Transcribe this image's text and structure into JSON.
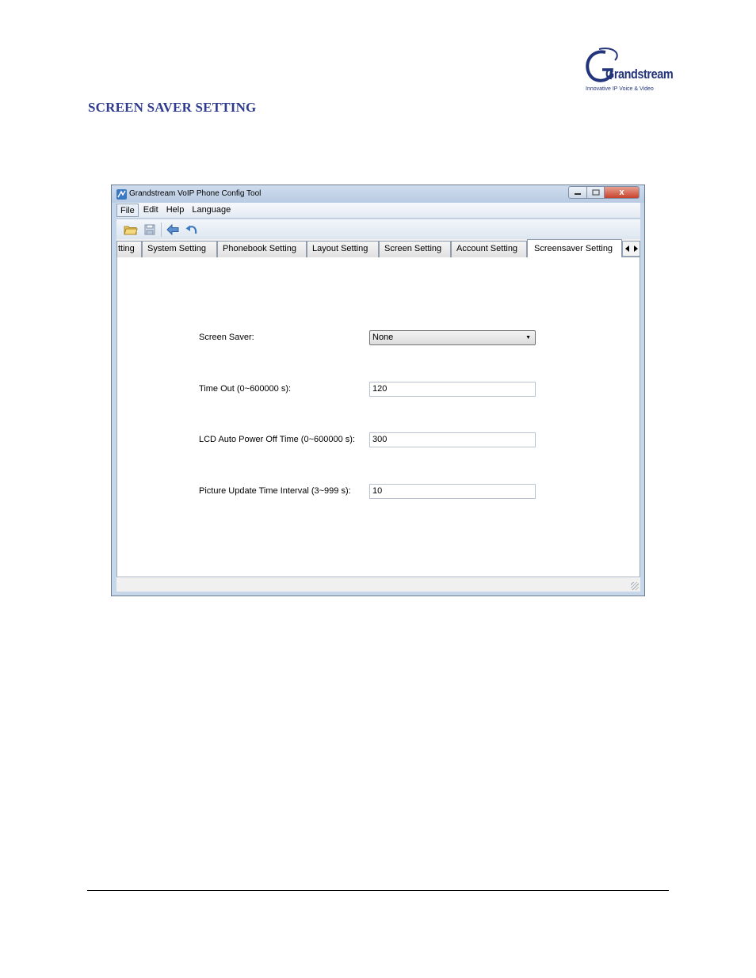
{
  "header": {
    "logo": {
      "name": "Grandstream",
      "tagline": "Innovative IP Voice & Video"
    },
    "section_title": "SCREEN SAVER SETTING"
  },
  "window": {
    "title": "Grandstream VoIP Phone Config Tool",
    "controls": {
      "minimize_icon": "minimize-icon",
      "maximize_icon": "maximize-icon",
      "close": "x"
    },
    "menu": [
      {
        "label": "File"
      },
      {
        "label": "Edit"
      },
      {
        "label": "Help"
      },
      {
        "label": "Language"
      }
    ],
    "toolbar": [
      "open-folder-icon",
      "save-icon",
      "back-arrow-icon",
      "undo-icon"
    ],
    "tabs": [
      {
        "label": "tting"
      },
      {
        "label": "System Setting"
      },
      {
        "label": "Phonebook Setting"
      },
      {
        "label": "Layout Setting"
      },
      {
        "label": "Screen Setting"
      },
      {
        "label": "Account Setting"
      },
      {
        "label": "Screensaver Setting",
        "selected": true
      }
    ],
    "form": {
      "screen_saver": {
        "label": "Screen Saver:",
        "value": "None"
      },
      "time_out": {
        "label": "Time Out (0~600000 s):",
        "value": "120"
      },
      "lcd_off": {
        "label": "LCD Auto Power Off Time (0~600000 s):",
        "value": "300"
      },
      "picture_interval": {
        "label": "Picture Update Time Interval (3~999 s):",
        "value": "10"
      }
    }
  },
  "colors": {
    "title_blue": "#2f3b8f",
    "window_frame": "#c6d7ea",
    "close_red": "#c7422c"
  }
}
